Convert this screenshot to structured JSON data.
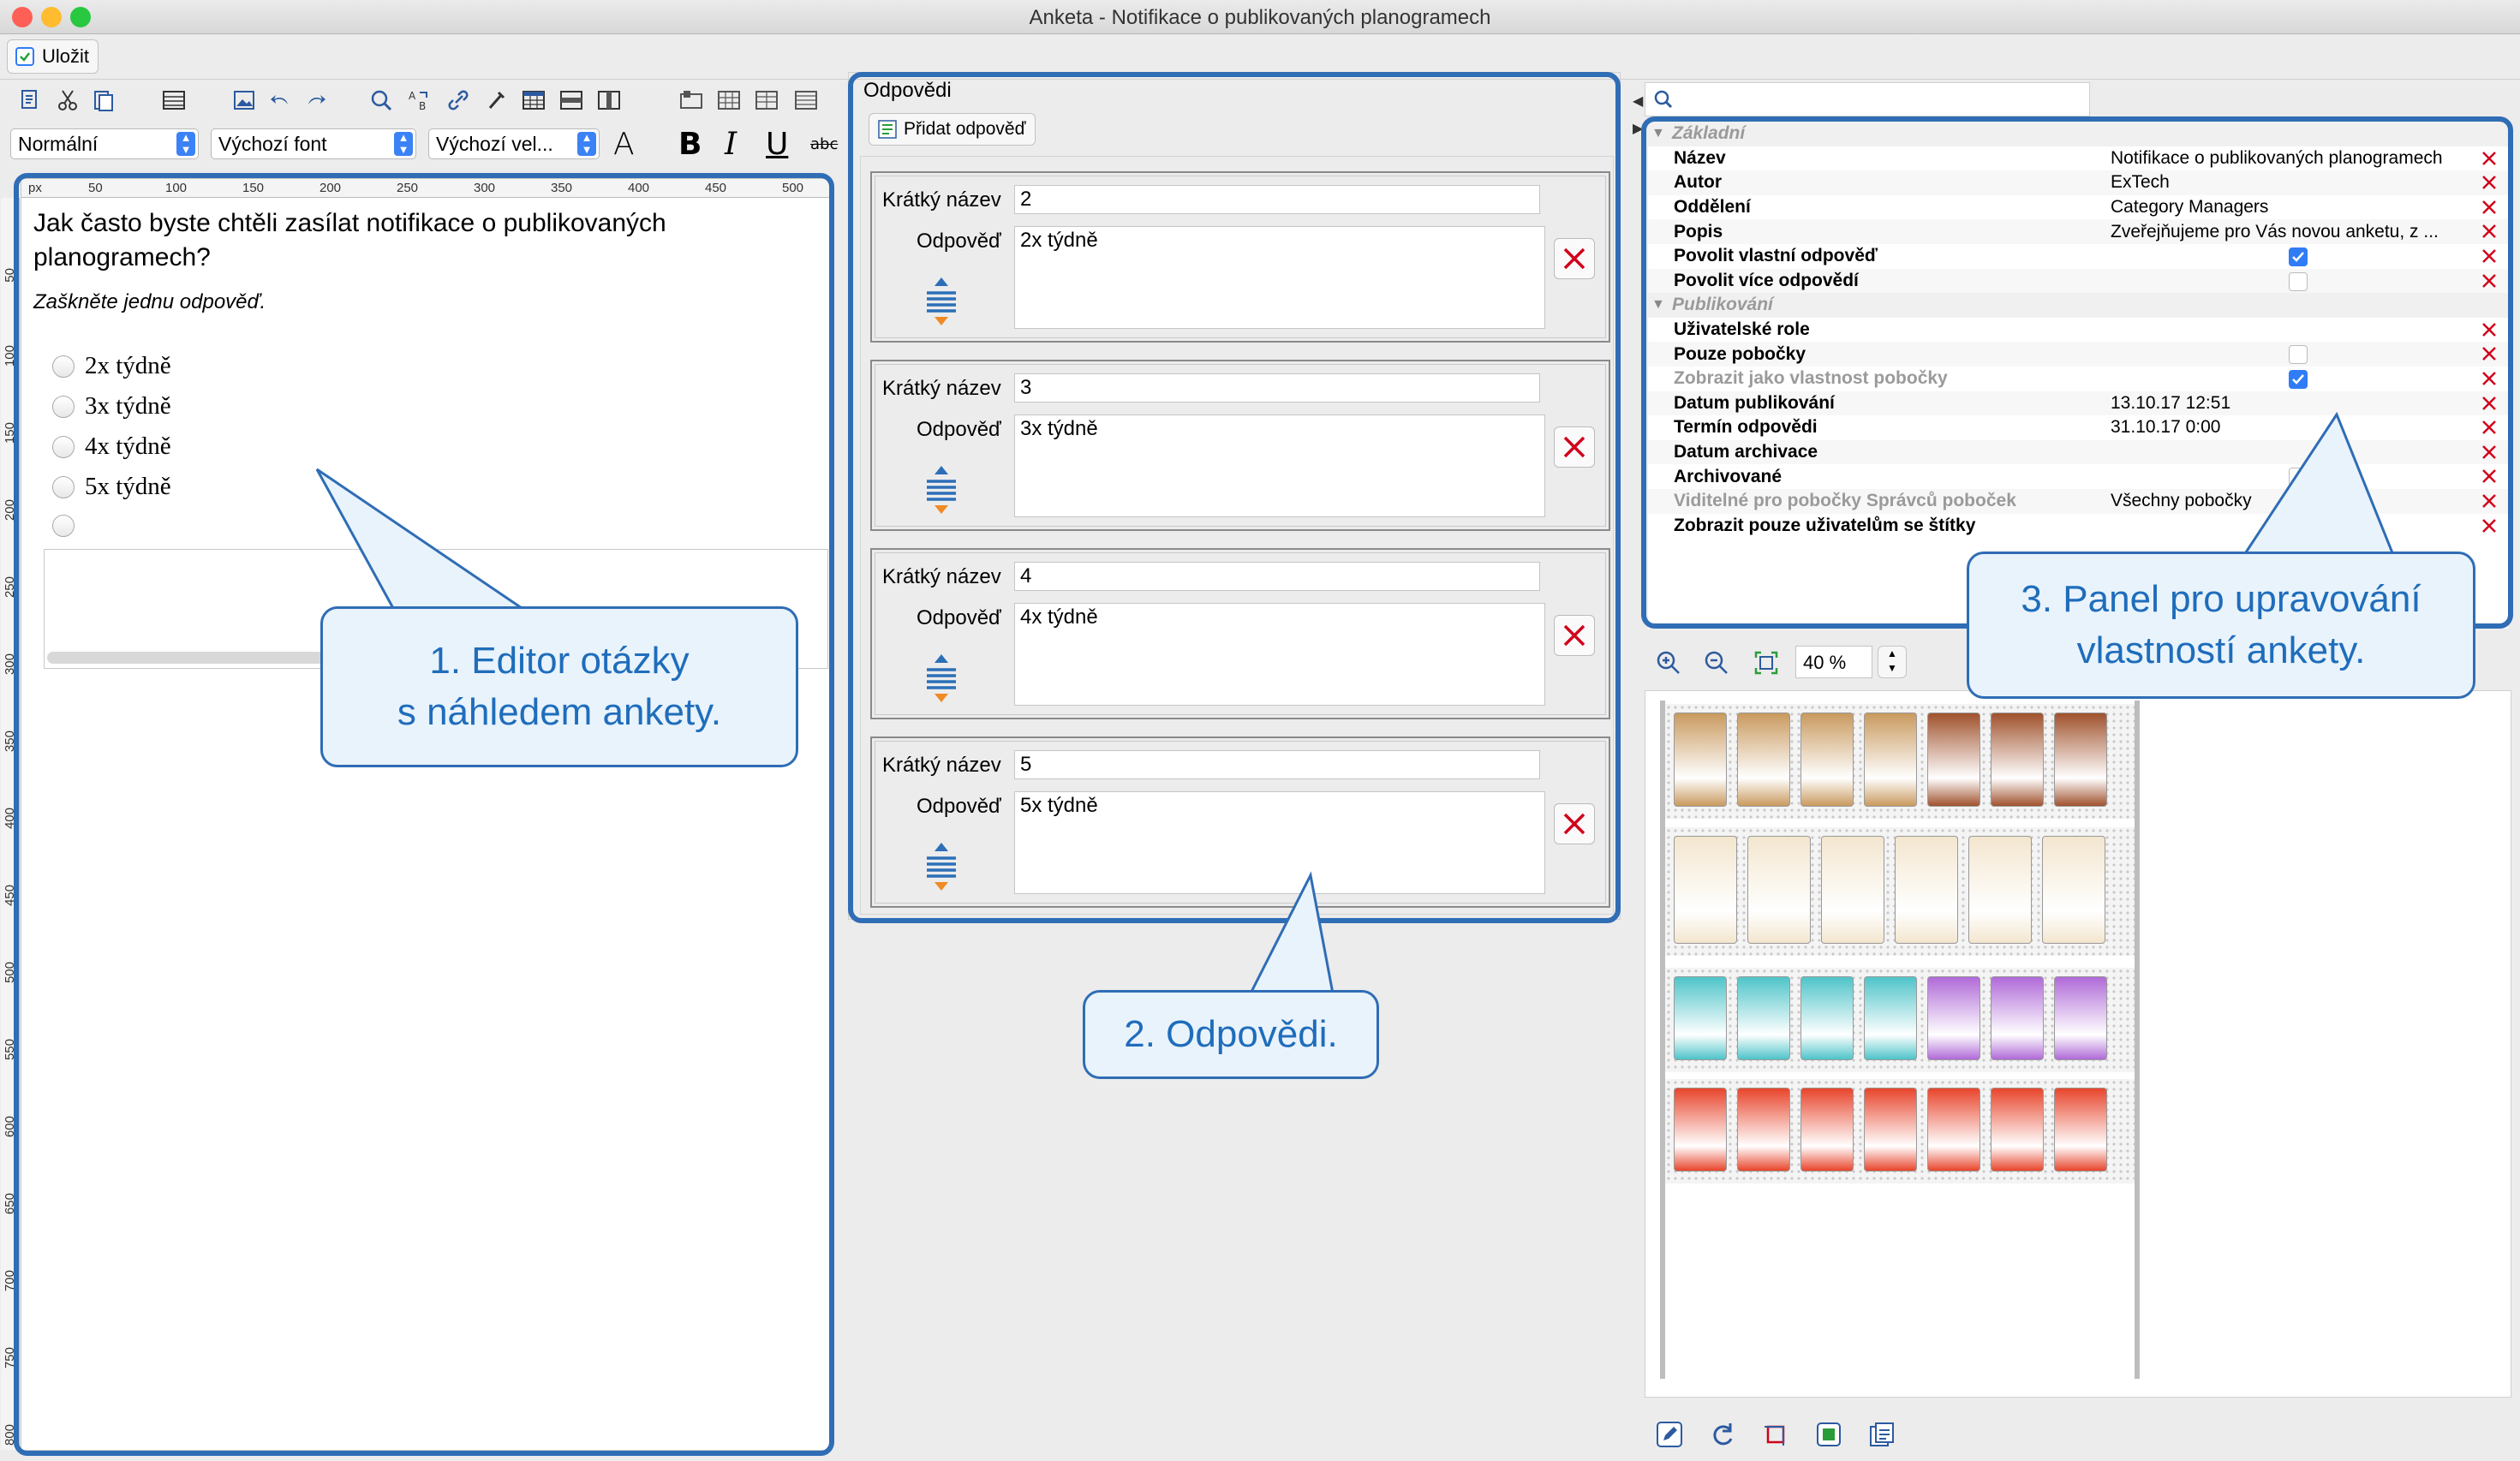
{
  "window": {
    "title": "Anketa - Notifikace o publikovaných planogramech"
  },
  "toolbar": {
    "save_label": "Uložit",
    "style_select": "Normální",
    "font_select": "Výchozí font",
    "size_select": "Výchozí vel...",
    "font_color_glyph": "A",
    "bold_glyph": "B",
    "italic_glyph": "I",
    "underline_glyph": "U",
    "strike_glyph": "abc"
  },
  "editor": {
    "ruler_unit": "px",
    "ruler_h": [
      "50",
      "100",
      "150",
      "200",
      "250",
      "300",
      "350",
      "400",
      "450",
      "500"
    ],
    "ruler_v": [
      "50",
      "100",
      "150",
      "200",
      "250",
      "300",
      "350",
      "400",
      "450",
      "500",
      "550",
      "600",
      "650",
      "700",
      "750",
      "800"
    ],
    "question": "Jak často byste chtěli zasílat notifikace o publikovaných planogramech?",
    "hint": "Zaškněte jednu odpověď.",
    "options": [
      "2x týdně",
      "3x týdně",
      "4x týdně",
      "5x týdně"
    ]
  },
  "answers": {
    "title": "Odpovědi",
    "add_button": "Přidat odpověď",
    "short_label": "Krátký název",
    "answer_label": "Odpověď",
    "items": [
      {
        "short": "2",
        "answer": "2x týdně"
      },
      {
        "short": "3",
        "answer": "3x týdně"
      },
      {
        "short": "4",
        "answer": "4x týdně"
      },
      {
        "short": "5",
        "answer": "5x týdně"
      }
    ]
  },
  "properties": {
    "groups": [
      {
        "name": "Základní",
        "rows": [
          {
            "key": "Název",
            "value": "Notifikace o publikovaných planogramech",
            "dim": false
          },
          {
            "key": "Autor",
            "value": "ExTech",
            "dim": false
          },
          {
            "key": "Oddělení",
            "value": "Category Managers",
            "dim": false
          },
          {
            "key": "Popis",
            "value": "Zveřejňujeme pro Vás novou anketu, z ...",
            "dim": false
          },
          {
            "key": "Povolit vlastní odpověď",
            "checkbox": true,
            "dim": false
          },
          {
            "key": "Povolit více odpovědí",
            "checkbox": false,
            "dim": false
          }
        ]
      },
      {
        "name": "Publikování",
        "rows": [
          {
            "key": "Uživatelské role",
            "value": "",
            "dim": false
          },
          {
            "key": "Pouze pobočky",
            "checkbox": false,
            "dim": false
          },
          {
            "key": "Zobrazit jako vlastnost pobočky",
            "checkbox": true,
            "dim": true
          },
          {
            "key": "Datum publikování",
            "value": "13.10.17 12:51",
            "dim": false
          },
          {
            "key": "Termín odpovědi",
            "value": "31.10.17 0:00",
            "dim": false
          },
          {
            "key": "Datum archivace",
            "value": "",
            "dim": false
          },
          {
            "key": "Archivované",
            "checkbox": false,
            "dim": false
          },
          {
            "key": "Viditelné pro pobočky Správců poboček",
            "value": "Všechny pobočky",
            "dim": true
          },
          {
            "key": "Zobrazit pouze uživatelům se štítky",
            "value": "",
            "dim": false
          }
        ]
      }
    ]
  },
  "planogram": {
    "zoom": "40 %"
  },
  "callouts": {
    "c1_line1": "1. Editor otázky",
    "c1_line2": "s náhledem ankety.",
    "c2": "2. Odpovědi.",
    "c3_line1": "3. Panel pro upravování",
    "c3_line2": "vlastností ankety."
  },
  "colors": {
    "accent": "#2f6db5",
    "callout_bg": "#e9f3fc",
    "delete": "#d0021b",
    "checkbox": "#2f7cf6"
  }
}
